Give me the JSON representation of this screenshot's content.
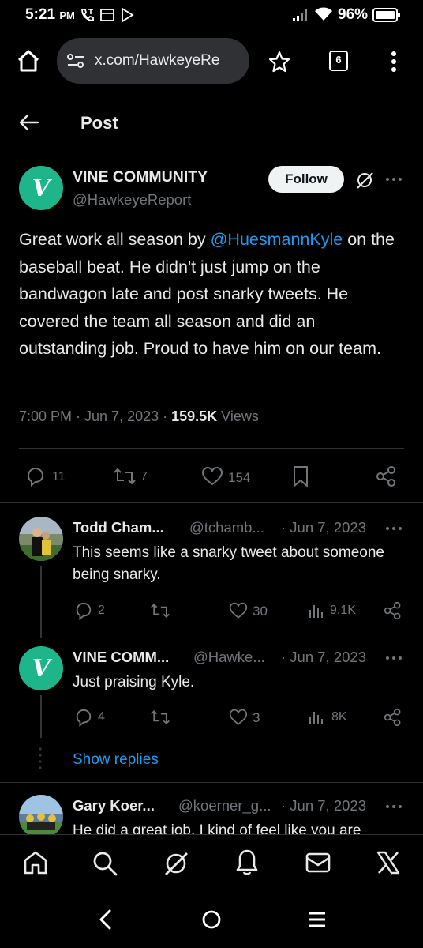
{
  "status_bar": {
    "time": "5:21",
    "ampm": "PM",
    "battery": "96%"
  },
  "browser": {
    "url": "x.com/HawkeyeRe",
    "tab_count": "6"
  },
  "header": {
    "title": "Post"
  },
  "tweet": {
    "author_name": "VINE COMMUNITY",
    "author_handle": "@HawkeyeReport",
    "follow_label": "Follow",
    "text_before": "Great work all season by ",
    "mention": "@HuesmannKyle",
    "text_after": " on the baseball beat. He didn't just jump on the bandwagon late and post snarky tweets. He covered the team all season and did an outstanding job. Proud to have him on our team.",
    "time": "7:00 PM · Jun 7, 2023 · ",
    "views_count": "159.5K",
    "views_label": " Views",
    "replies": "11",
    "reposts": "7",
    "likes": "154"
  },
  "replies": [
    {
      "name": "Todd Cham...",
      "handle": "@tchamb...",
      "date": "· Jun 7, 2023",
      "text": "This seems like a snarky tweet about someone being snarky.",
      "replies": "2",
      "reposts": "",
      "likes": "30",
      "views": "9.1K"
    },
    {
      "name": "VINE COMM...",
      "handle": "@Hawke...",
      "date": "· Jun 7, 2023",
      "text": "Just praising Kyle.",
      "replies": "4",
      "reposts": "",
      "likes": "3",
      "views": "8K"
    },
    {
      "name": "Gary Koer...",
      "handle": "@koerner_g...",
      "date": "· Jun 7, 2023",
      "text": "He did a great job. I kind of feel like you are"
    }
  ],
  "show_replies_label": "Show replies",
  "colors": {
    "accent": "#1d9bf0",
    "vine_green": "#1fb58a",
    "muted": "#71767b"
  }
}
